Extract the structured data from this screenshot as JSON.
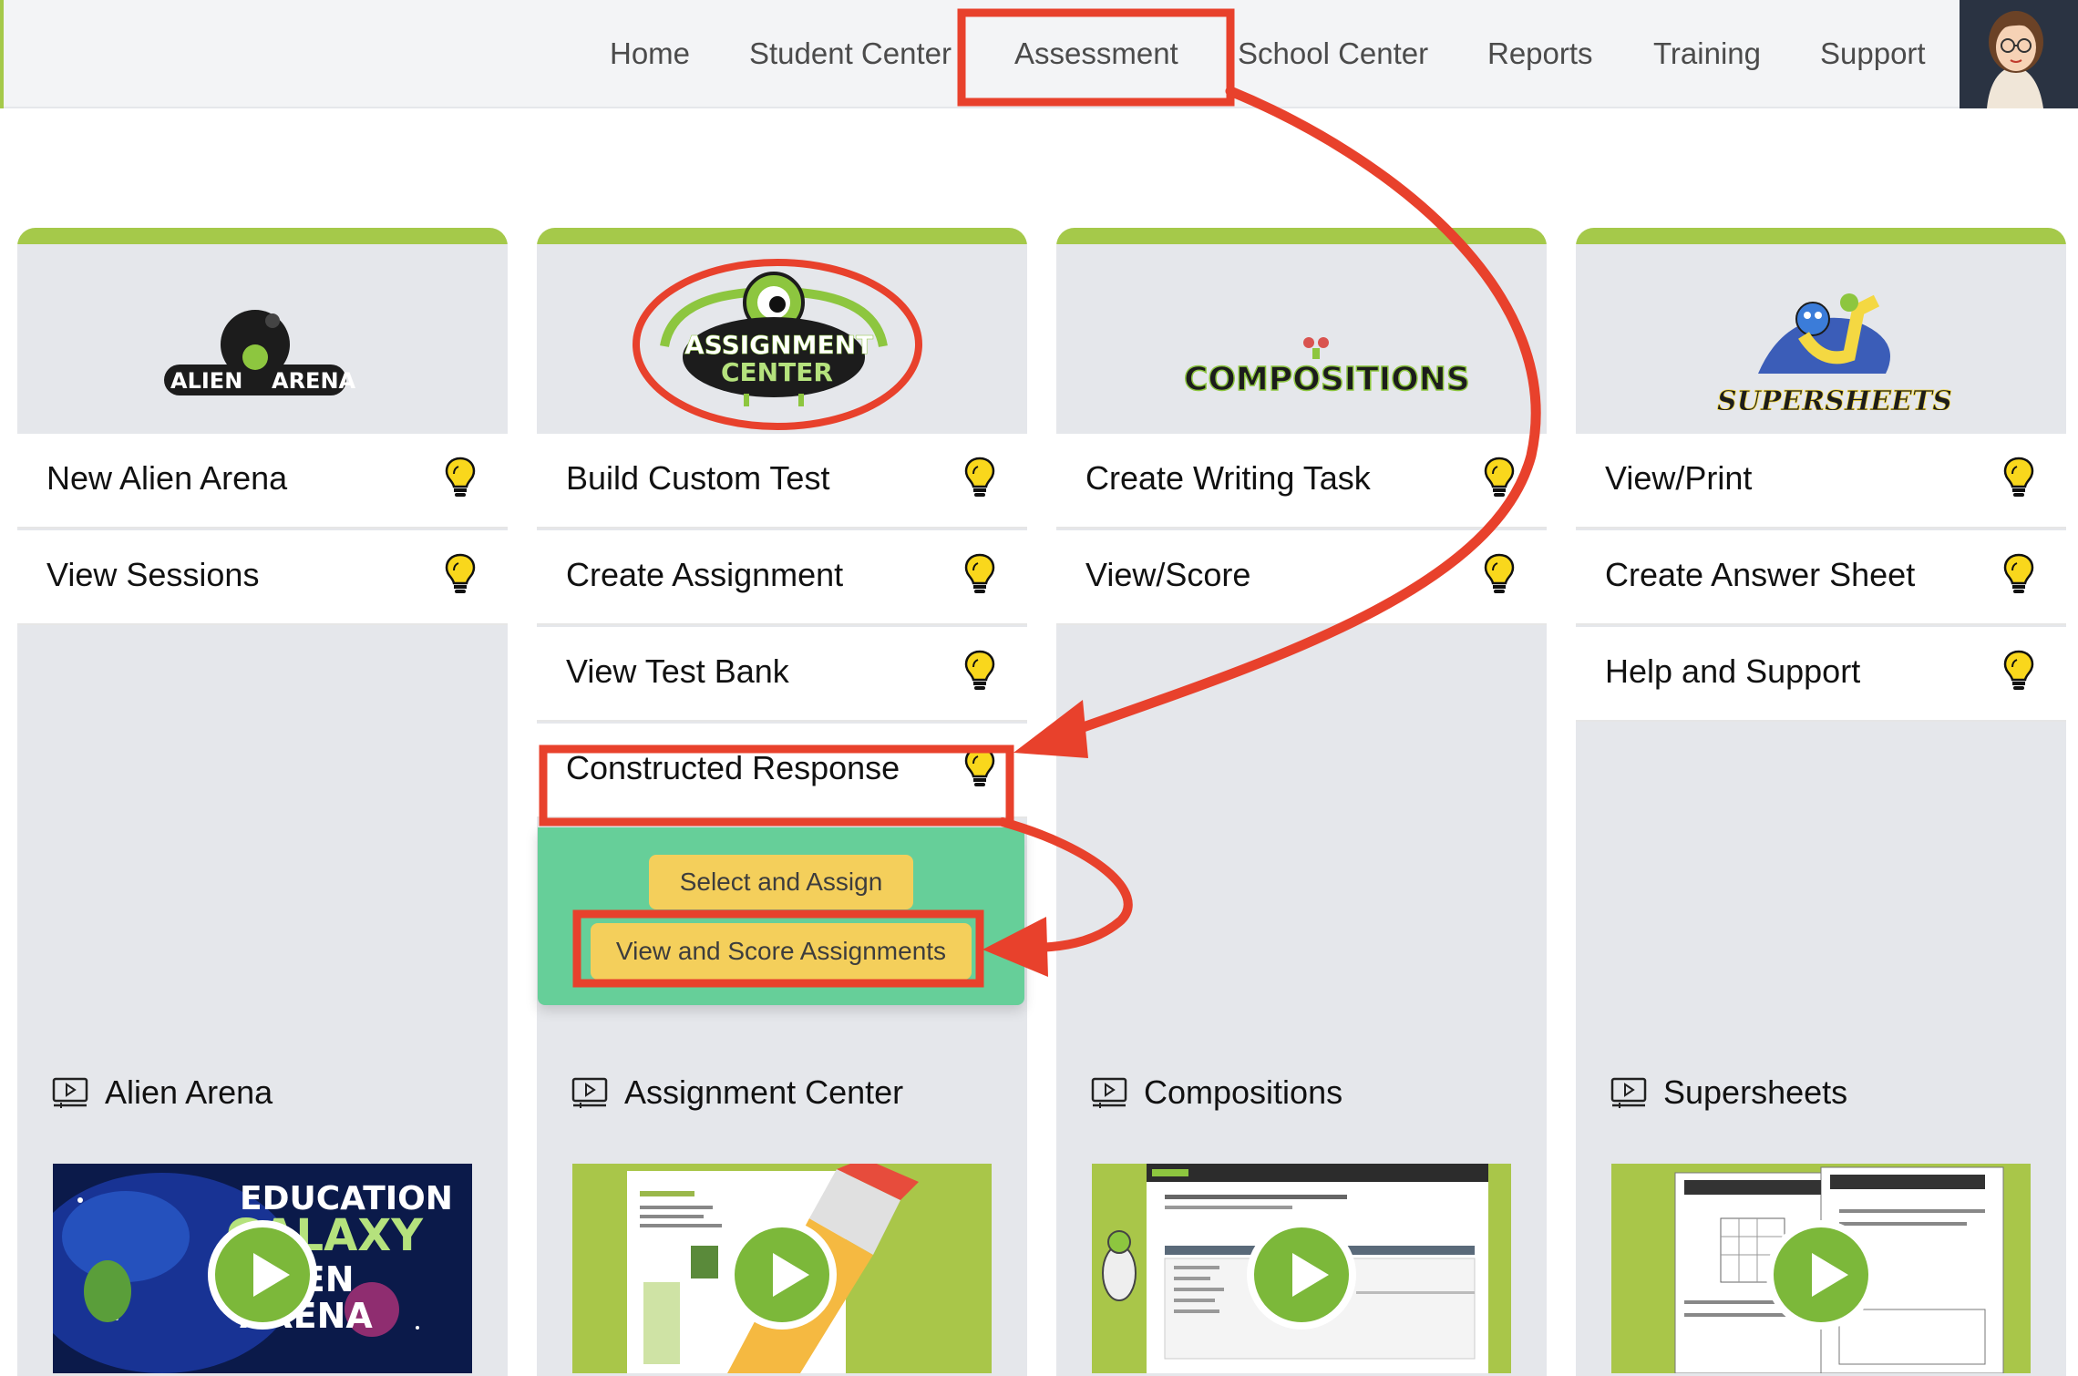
{
  "nav": {
    "items": [
      "Home",
      "Student Center",
      "Assessment",
      "School Center",
      "Reports",
      "Training",
      "Support"
    ]
  },
  "columns": [
    {
      "logo_text": [
        "ALIEN",
        "ARENA"
      ],
      "items": [
        "New Alien Arena",
        "View Sessions"
      ],
      "video_title": "Alien Arena",
      "thumb_text": [
        "EDUCATION",
        "GALAXY",
        "ALIEN",
        "ARENA"
      ]
    },
    {
      "logo_text": [
        "ASSIGNMENT",
        "CENTER"
      ],
      "items": [
        "Build Custom Test",
        "Create Assignment",
        "View Test Bank",
        "Constructed Response"
      ],
      "video_title": "Assignment Center"
    },
    {
      "logo_text": [
        "COMPOSITIONS"
      ],
      "items": [
        "Create Writing Task",
        "View/Score"
      ],
      "video_title": "Compositions"
    },
    {
      "logo_text": [
        "SUPERSHEETS"
      ],
      "items": [
        "View/Print",
        "Create Answer Sheet",
        "Help and Support"
      ],
      "video_title": "Supersheets"
    }
  ],
  "dropdown": {
    "select_assign": "Select and Assign",
    "view_score": "View and Score Assignments"
  },
  "colors": {
    "accent_green": "#a5c94a",
    "dropdown_green": "#66cf99",
    "button_yellow": "#f4cf5b",
    "annotation_red": "#e8412c",
    "bulb_yellow": "#f9d71c"
  }
}
